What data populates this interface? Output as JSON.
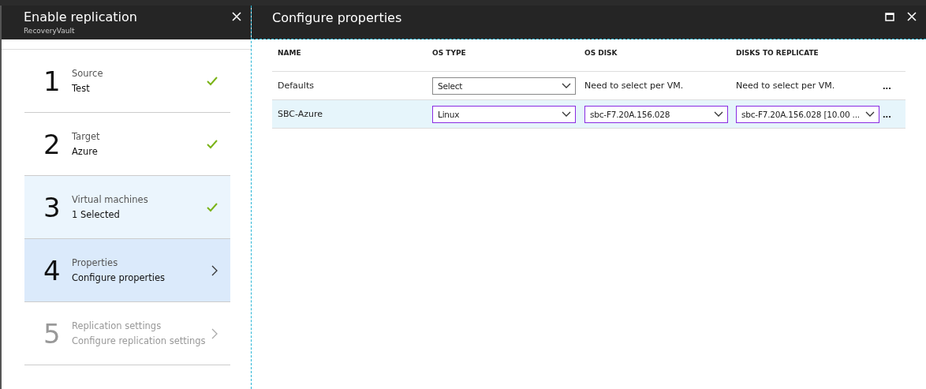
{
  "left_blade": {
    "title": "Enable replication",
    "subtitle": "RecoveryVault"
  },
  "steps": [
    {
      "number": "1",
      "title": "Source",
      "value": "Test",
      "done": true,
      "disabled": false,
      "selected": false,
      "hovered": false
    },
    {
      "number": "2",
      "title": "Target",
      "value": "Azure",
      "done": true,
      "disabled": false,
      "selected": false,
      "hovered": false
    },
    {
      "number": "3",
      "title": "Virtual machines",
      "value": "1 Selected",
      "done": true,
      "disabled": false,
      "selected": false,
      "hovered": true
    },
    {
      "number": "4",
      "title": "Properties",
      "value": "Configure properties",
      "done": false,
      "disabled": false,
      "selected": true,
      "hovered": false
    },
    {
      "number": "5",
      "title": "Replication settings",
      "value": "Configure replication settings",
      "done": false,
      "disabled": true,
      "selected": false,
      "hovered": false
    }
  ],
  "right_blade": {
    "title": "Configure properties"
  },
  "table": {
    "columns": [
      "NAME",
      "OS TYPE",
      "OS DISK",
      "DISKS TO REPLICATE"
    ],
    "rows": [
      {
        "selected": false,
        "cells": [
          {
            "kind": "text",
            "value": "Defaults"
          },
          {
            "kind": "select",
            "value": "Select"
          },
          {
            "kind": "text",
            "value": "Need to select per VM."
          },
          {
            "kind": "text",
            "value": "Need to select per VM."
          }
        ],
        "more": "..."
      },
      {
        "selected": true,
        "cells": [
          {
            "kind": "text",
            "value": "SBC-Azure"
          },
          {
            "kind": "select",
            "value": "Linux"
          },
          {
            "kind": "select",
            "value": "sbc-F7.20A.156.028"
          },
          {
            "kind": "select",
            "value": "sbc-F7.20A.156.028 [10.00 ..."
          }
        ],
        "more": "..."
      }
    ]
  }
}
